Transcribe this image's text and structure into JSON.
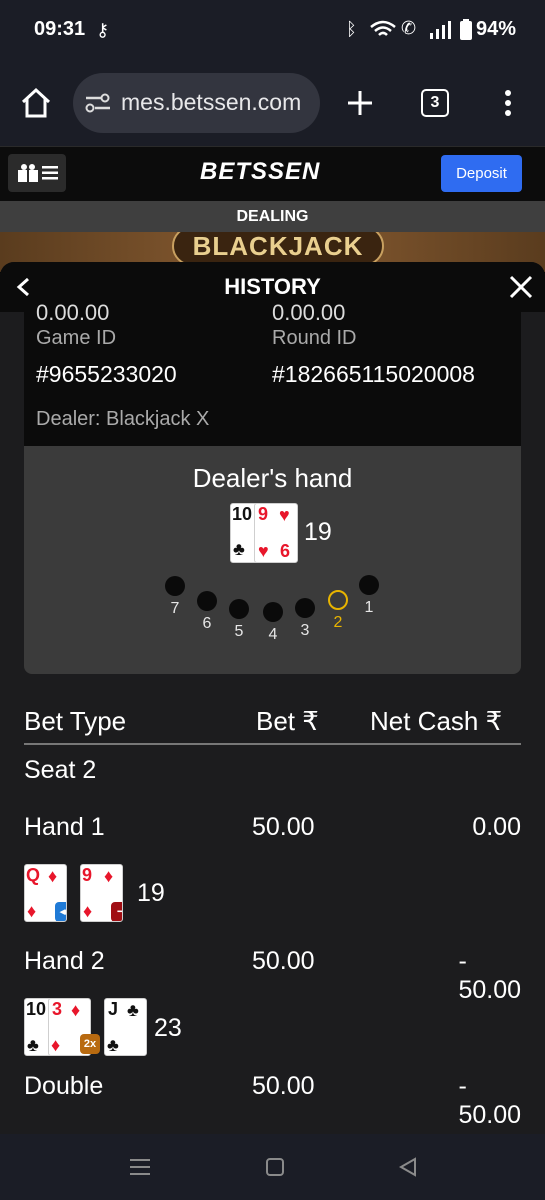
{
  "status": {
    "time": "09:31",
    "battery": "94%"
  },
  "browser": {
    "url": "mes.betssen.com",
    "tab_count": "3"
  },
  "site": {
    "logo": "BETSSEN",
    "deposit_label": "Deposit"
  },
  "game": {
    "state": "DEALING",
    "banner": "BLACKJACK"
  },
  "history": {
    "title": "HISTORY",
    "partial_top_left": "0.00.00",
    "partial_top_right": "0.00.00",
    "game_id_label": "Game ID",
    "game_id": "#9655233020",
    "round_id_label": "Round ID",
    "round_id": "#182665115020008",
    "dealer": "Dealer: Blackjack X",
    "dealer_hand_title": "Dealer's hand",
    "dealer_total": "19",
    "dealer_cards": [
      {
        "rank": "10",
        "suit": "♣",
        "color": "#111111"
      },
      {
        "rank": "9",
        "suit": "♥",
        "rank2": "6",
        "color": "#e8162b"
      }
    ],
    "seats": [
      "7",
      "6",
      "5",
      "4",
      "3",
      "2",
      "1"
    ],
    "active_seat": "2"
  },
  "table": {
    "headers": {
      "bet_type": "Bet Type",
      "bet": "Bet ₹",
      "net_cash": "Net Cash ₹"
    },
    "seat_label": "Seat 2",
    "rows": [
      {
        "type": "Hand 1",
        "bet": "50.00",
        "net": "0.00",
        "total": "19"
      },
      {
        "type": "Hand 2",
        "bet": "50.00",
        "net": "- 50.00",
        "total": "23"
      },
      {
        "type": "Double",
        "bet": "50.00",
        "net": "- 50.00"
      }
    ],
    "hand1_cards": [
      {
        "rank": "Q",
        "suit": "♦",
        "badge": "split"
      },
      {
        "rank": "9",
        "suit": "♦",
        "badge": "minus"
      }
    ],
    "hand2_cards": [
      {
        "rank": "10",
        "suit": "♣"
      },
      {
        "rank": "3",
        "suit": "♦",
        "badge": "2x"
      },
      {
        "rank": "J",
        "suit": "♣"
      }
    ],
    "badge_2x": "2x"
  },
  "colors": {
    "deposit": "#2f6cf1",
    "active_seat": "#e8b400",
    "panel": "#3b3b3b",
    "modal": "#1c1c1e"
  }
}
